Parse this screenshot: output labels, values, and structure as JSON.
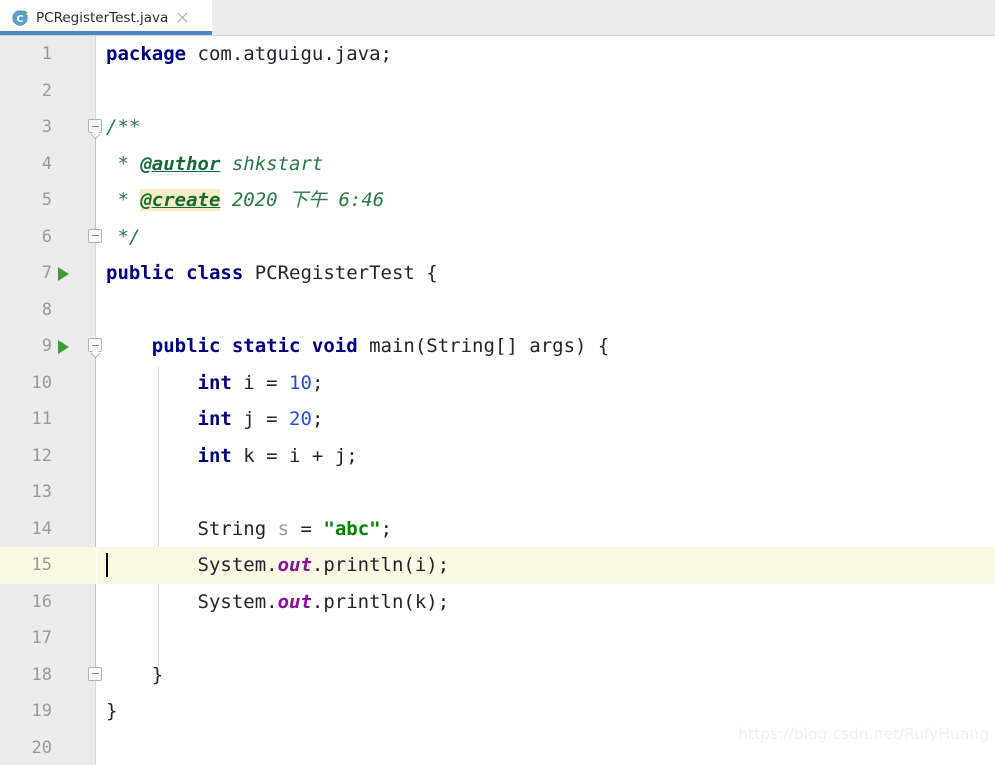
{
  "window": {
    "app": "IntelliJ IDEA Editor"
  },
  "tab": {
    "label": "PCRegisterTest.java",
    "icon": "java-class-runnable-icon",
    "close_icon": "close-icon",
    "accent_color": "#4a86c8",
    "active": true
  },
  "editor": {
    "language": "java",
    "current_line": 15,
    "total_lines": 20,
    "caret_line": 15,
    "gutter_bg": "#ececec",
    "current_line_bg": "#fcf8e3",
    "lines": [
      {
        "n": "1",
        "run": false,
        "text": "package com.atguigu.java;",
        "tokens": [
          {
            "t": "package",
            "c": "kw"
          },
          {
            "t": " com.atguigu.java;",
            "c": "plain"
          }
        ]
      },
      {
        "n": "2",
        "run": false,
        "text": "",
        "tokens": []
      },
      {
        "n": "3",
        "run": false,
        "text": "/**",
        "tokens": [
          {
            "t": "/**",
            "c": "cmt"
          }
        ]
      },
      {
        "n": "4",
        "run": false,
        "text": " * @author shkstart",
        "tokens": [
          {
            "t": " * ",
            "c": "cmt"
          },
          {
            "t": "@author",
            "c": "tag"
          },
          {
            "t": " shkstart",
            "c": "cmt"
          }
        ]
      },
      {
        "n": "5",
        "run": false,
        "text": " * @create 2020 下午 6:46",
        "tokens": [
          {
            "t": " * ",
            "c": "cmt"
          },
          {
            "t": "@create",
            "c": "tag tag-hl"
          },
          {
            "t": " 2020 下午 6:46",
            "c": "cmt"
          }
        ]
      },
      {
        "n": "6",
        "run": false,
        "text": " */",
        "tokens": [
          {
            "t": " */",
            "c": "cmt"
          }
        ]
      },
      {
        "n": "7",
        "run": true,
        "text": "public class PCRegisterTest {",
        "tokens": [
          {
            "t": "public class",
            "c": "kw"
          },
          {
            "t": " PCRegisterTest {",
            "c": "plain"
          }
        ]
      },
      {
        "n": "8",
        "run": false,
        "text": "",
        "tokens": []
      },
      {
        "n": "9",
        "run": true,
        "text": "    public static void main(String[] args) {",
        "tokens": [
          {
            "t": "    ",
            "c": "plain"
          },
          {
            "t": "public static void",
            "c": "kw"
          },
          {
            "t": " main(String[] args) {",
            "c": "plain"
          }
        ]
      },
      {
        "n": "10",
        "run": false,
        "text": "        int i = 10;",
        "tokens": [
          {
            "t": "        ",
            "c": "plain"
          },
          {
            "t": "int",
            "c": "kw"
          },
          {
            "t": " i = ",
            "c": "plain"
          },
          {
            "t": "10",
            "c": "num"
          },
          {
            "t": ";",
            "c": "plain"
          }
        ]
      },
      {
        "n": "11",
        "run": false,
        "text": "        int j = 20;",
        "tokens": [
          {
            "t": "        ",
            "c": "plain"
          },
          {
            "t": "int",
            "c": "kw"
          },
          {
            "t": " j = ",
            "c": "plain"
          },
          {
            "t": "20",
            "c": "num"
          },
          {
            "t": ";",
            "c": "plain"
          }
        ]
      },
      {
        "n": "12",
        "run": false,
        "text": "        int k = i + j;",
        "tokens": [
          {
            "t": "        ",
            "c": "plain"
          },
          {
            "t": "int",
            "c": "kw"
          },
          {
            "t": " k = i + j;",
            "c": "plain"
          }
        ]
      },
      {
        "n": "13",
        "run": false,
        "text": "",
        "tokens": []
      },
      {
        "n": "14",
        "run": false,
        "text": "        String s = \"abc\";",
        "tokens": [
          {
            "t": "        String ",
            "c": "plain"
          },
          {
            "t": "s",
            "c": "unused"
          },
          {
            "t": " = ",
            "c": "plain"
          },
          {
            "t": "\"abc\"",
            "c": "str"
          },
          {
            "t": ";",
            "c": "plain"
          }
        ]
      },
      {
        "n": "15",
        "run": false,
        "text": "        System.out.println(i);",
        "tokens": [
          {
            "t": "        System.",
            "c": "plain"
          },
          {
            "t": "out",
            "c": "field"
          },
          {
            "t": ".println(i);",
            "c": "plain"
          }
        ]
      },
      {
        "n": "16",
        "run": false,
        "text": "        System.out.println(k);",
        "tokens": [
          {
            "t": "        System.",
            "c": "plain"
          },
          {
            "t": "out",
            "c": "field"
          },
          {
            "t": ".println(k);",
            "c": "plain"
          }
        ]
      },
      {
        "n": "17",
        "run": false,
        "text": "",
        "tokens": []
      },
      {
        "n": "18",
        "run": false,
        "text": "    }",
        "tokens": [
          {
            "t": "    }",
            "c": "plain"
          }
        ]
      },
      {
        "n": "19",
        "run": false,
        "text": "}",
        "tokens": [
          {
            "t": "}",
            "c": "plain"
          }
        ]
      },
      {
        "n": "20",
        "run": false,
        "text": "",
        "tokens": []
      }
    ]
  },
  "watermark": {
    "text": "https://blog.csdn.net/RufyHuang"
  }
}
